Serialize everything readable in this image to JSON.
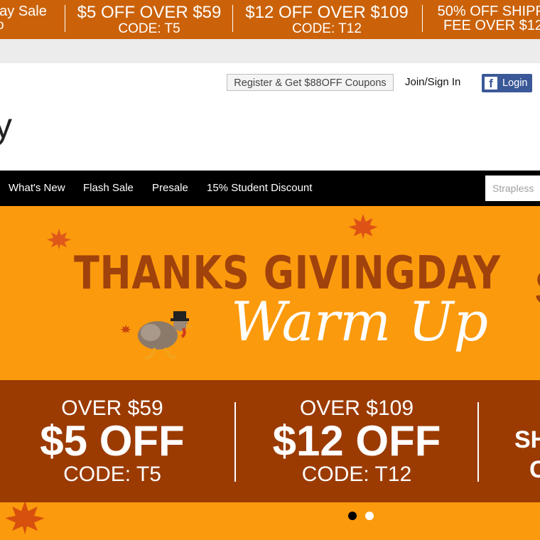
{
  "promo_strip": {
    "segments": [
      {
        "line1": "ay Sale",
        "line2": "o"
      },
      {
        "line1": "$5 OFF OVER $59",
        "line2": "CODE: T5"
      },
      {
        "line1": "$12 OFF OVER $109",
        "line2": "CODE: T12"
      },
      {
        "line1": "50% OFF SHIPPI",
        "line2": "FEE OVER $12"
      }
    ]
  },
  "header": {
    "register_label": "Register & Get $88OFF Coupons",
    "join_label": "Join/Sign In",
    "fb_login_label": "Login",
    "fb_icon_glyph": "f",
    "logo_fragment": "y"
  },
  "nav": {
    "items": [
      "What's New",
      "Flash Sale",
      "Presale",
      "15% Student Discount"
    ],
    "search_placeholder": "Strapless"
  },
  "banner": {
    "headline": "THANKS GIVINGDAY",
    "headline_peek": "S",
    "script": "Warm Up",
    "offers": [
      {
        "line1": "OVER $59",
        "line2": "$5 OFF",
        "line3": "CODE: T5"
      },
      {
        "line1": "OVER $109",
        "line2": "$12 OFF",
        "line3": "CODE: T12"
      }
    ],
    "partial_line1": "SH",
    "partial_line2": "C"
  },
  "carousel": {
    "active_index": 0,
    "count": 2
  },
  "colors": {
    "promo": "#cb6209",
    "banner": "#fb9a0d",
    "band": "#9b3b02",
    "headline": "#a0420c",
    "facebook": "#3b5998"
  }
}
